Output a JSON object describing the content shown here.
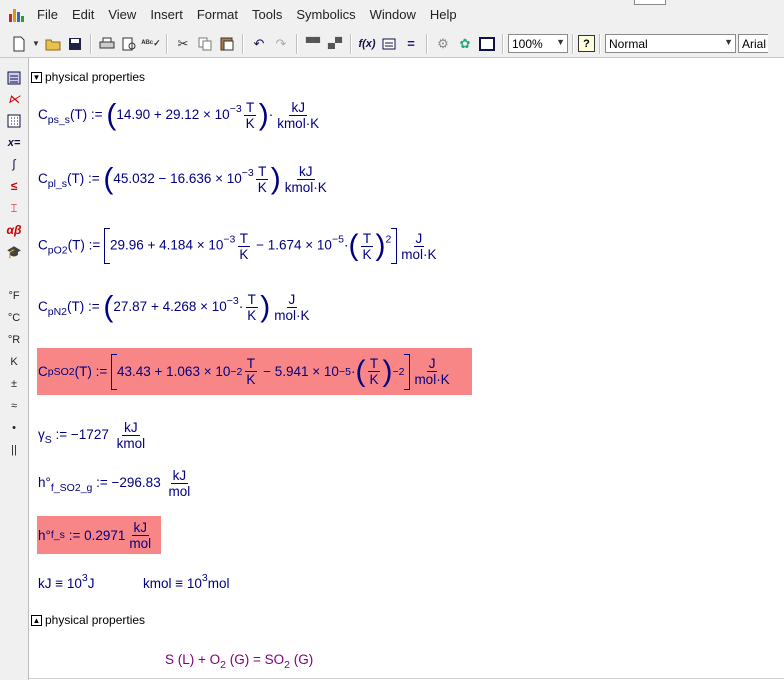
{
  "menu": [
    "File",
    "Edit",
    "View",
    "Insert",
    "Format",
    "Tools",
    "Symbolics",
    "Window",
    "Help"
  ],
  "toolbar": {
    "zoom": "100%",
    "style": "Normal",
    "font": "Arial"
  },
  "palette_icons": [
    "calculator-icon",
    "graph-icon",
    "matrix-icon",
    "evaluation-icon",
    "calculus-icon",
    "boolean-icon",
    "programming-icon",
    "greek-icon",
    "symbolic-icon",
    "fahrenheit-icon",
    "celsius-icon",
    "rankine-icon",
    "kelvin-icon",
    "plus-minus-icon",
    "approx-icon",
    "bullet-icon",
    "parallel-icon"
  ],
  "palette_labels": [
    "°F",
    "°C",
    "°R",
    "K",
    "±",
    "≈",
    "•",
    "||"
  ],
  "sections": {
    "top": "physical properties",
    "bottom": "physical properties"
  },
  "equations": {
    "cps": {
      "name": "C",
      "sub": "ps_s",
      "arg": "(T) :=",
      "poly": "14.90 + 29.12 × 10",
      "exp": "−3",
      "unit_n": "kJ",
      "unit_d": "kmol·K"
    },
    "cpl": {
      "name": "C",
      "sub": "pl_s",
      "arg": "(T) :=",
      "poly": "45.032 − 16.636 × 10",
      "exp": "−3",
      "unit_n": "kJ",
      "unit_d": "kmol·K"
    },
    "cpo2": {
      "name": "C",
      "sub": "pO2",
      "arg": "(T) :=",
      "poly": "29.96 + 4.184 × 10",
      "exp": "−3",
      "mid": "− 1.674 × 10",
      "exp2": "−5",
      "pow": "2",
      "unit_n": "J",
      "unit_d": "mol·K"
    },
    "cpn2": {
      "name": "C",
      "sub": "pN2",
      "arg": "(T) :=",
      "poly": "27.87 + 4.268 × 10",
      "exp": "−3",
      "unit_n": "J",
      "unit_d": "mol·K"
    },
    "cpso2": {
      "name": "C",
      "sub": "pSO2",
      "arg": "(T) :=",
      "poly": "43.43 + 1.063 × 10",
      "exp": "−2",
      "mid": "− 5.941 × 10",
      "exp2": "−5",
      "pow": "−2",
      "unit_n": "J",
      "unit_d": "mol·K"
    },
    "gamma": {
      "name": "γ",
      "sub": "S",
      "def": ":= −1727",
      "unit_n": "kJ",
      "unit_d": "kmol"
    },
    "hso2": {
      "name": "h°",
      "sub": "f_SO2_g",
      "def": ":= −296.83",
      "unit_n": "kJ",
      "unit_d": "mol"
    },
    "hs": {
      "name": "h°",
      "sub": "f_s",
      "def": ":= 0.2971",
      "unit_n": "kJ",
      "unit_d": "mol"
    },
    "kj": {
      "lhs": "kJ ≡ 10",
      "exp": "3",
      "rhs": "J"
    },
    "kmol": {
      "lhs": "kmol ≡ 10",
      "exp": "3",
      "rhs": "mol"
    }
  },
  "frac_T": {
    "n": "T",
    "d": "K"
  },
  "reaction": {
    "s": "S (L) + O",
    "o2sub": "2",
    "g": " (G) = SO",
    "so2sub": "2",
    "end": " (G)"
  },
  "colors": {
    "highlight": "#f98686",
    "math": "#000080",
    "reaction": "#800080"
  }
}
